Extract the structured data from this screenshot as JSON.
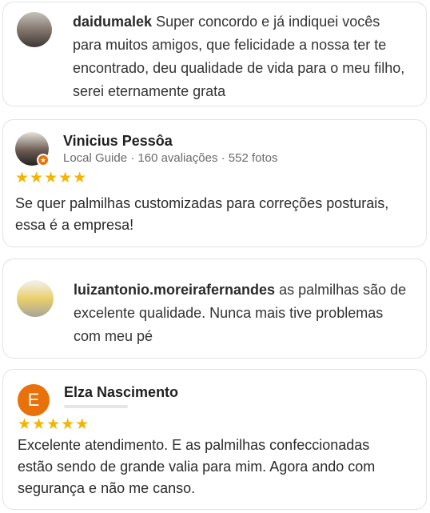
{
  "reviews": [
    {
      "username": "daidumalek",
      "text": "Super concordo e já indiquei vocês para muitos amigos, que felicidade a nossa ter te encontrado, deu qualidade de vida para o meu filho, serei eternamente grata"
    },
    {
      "name": "Vinicius Pessôa",
      "meta": "Local Guide · 160 avaliações · 552 fotos",
      "stars": "★★★★★",
      "text": "Se quer palmilhas customizadas para correções posturais, essa é a empresa!"
    },
    {
      "username": "luizantonio.moreirafernandes",
      "text": "as palmilhas são de excelente qualidade. Nunca mais tive problemas com meu pé"
    },
    {
      "name": "Elza Nascimento",
      "initial": "E",
      "stars": "★★★★★",
      "text": "Excelente atendimento. E as palmilhas confeccionadas estão sendo de grande valia para mim. Agora ando com segurança e não me canso."
    }
  ],
  "colors": {
    "star": "#f4b400",
    "avatar_orange": "#e8710a",
    "border": "#dfe3e8"
  }
}
